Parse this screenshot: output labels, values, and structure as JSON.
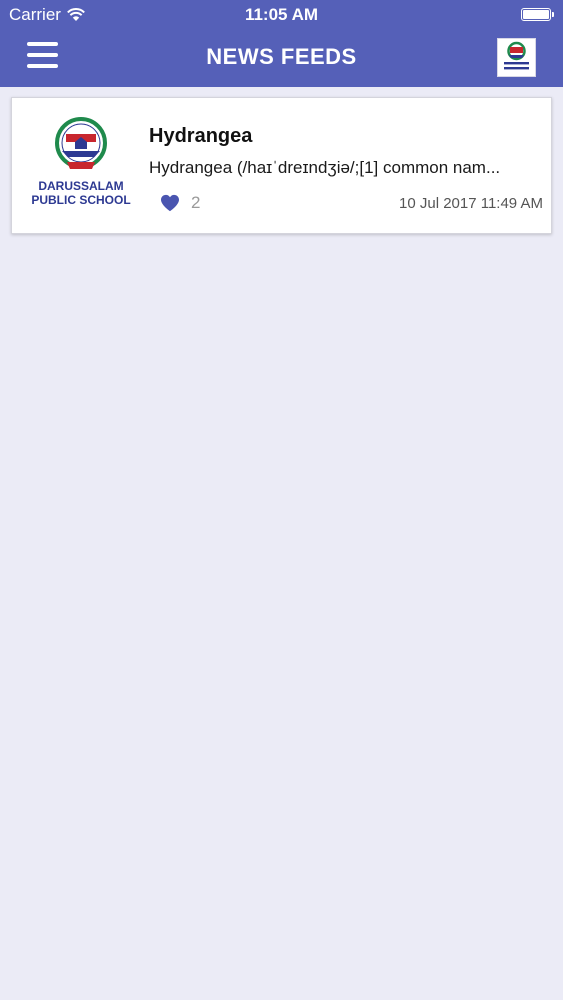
{
  "status_bar": {
    "carrier": "Carrier",
    "time": "11:05 AM"
  },
  "nav": {
    "title": "NEWS FEEDS",
    "menu_icon": "hamburger-menu-icon",
    "logo_icon": "school-logo"
  },
  "logo_text": {
    "line1": "DARUSSALAM",
    "line2": "PUBLIC SCHOOL"
  },
  "feed": [
    {
      "title": "Hydrangea",
      "summary": "Hydrangea (/haɪˈdreɪndʒiə/;[1] common nam...",
      "likes": "2",
      "date": "10 Jul 2017 11:49 AM"
    }
  ],
  "colors": {
    "header": "#5560b8",
    "background": "#ebebf6",
    "heart": "#4a55b0"
  }
}
